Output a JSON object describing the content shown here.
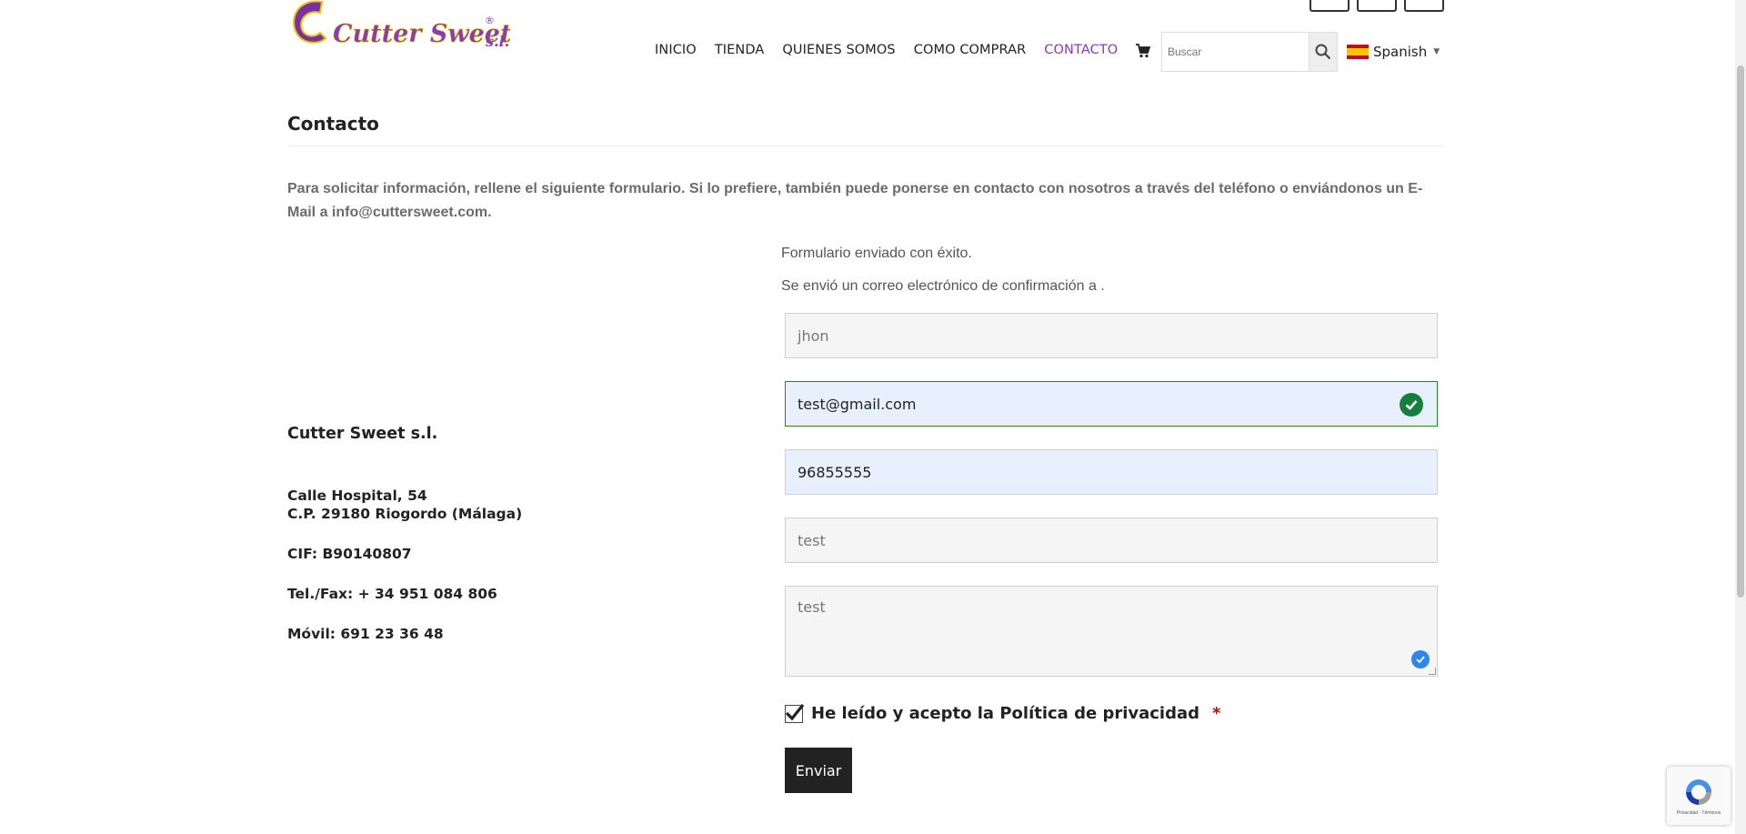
{
  "header": {
    "logo_text": "Cutter Sweet",
    "logo_suffix": "s.l.",
    "nav": [
      {
        "label": "INICIO"
      },
      {
        "label": "TIENDA"
      },
      {
        "label": "QUIENES SOMOS"
      },
      {
        "label": "COMO COMPRAR"
      },
      {
        "label": "CONTACTO",
        "active": true
      }
    ],
    "cart_icon": "shopping-cart-icon",
    "search": {
      "placeholder": "Buscar",
      "icon": "search-icon"
    },
    "language": {
      "label": "Spanish",
      "flag": "spain-flag-icon"
    }
  },
  "page": {
    "title": "Contacto",
    "intro": "Para solicitar información, rellene el siguiente formulario. Si lo prefiere, también puede ponerse en contacto con nosotros  a través del teléfono o enviándonos un E-Mail a info@cuttersweet.com."
  },
  "company": {
    "name": "Cutter Sweet s.l.",
    "address_line1": "Calle Hospital, 54",
    "address_line2": "C.P. 29180 Riogordo (Málaga)",
    "cif": "CIF: B90140807",
    "telfax": "Tel./Fax: + 34 951 084 806",
    "movil": "Móvil: 691 23 36 48"
  },
  "form": {
    "success_message": "Formulario enviado con éxito.",
    "confirmation_message": "Se envió un correo electrónico de confirmación a .",
    "name_value": "jhon",
    "email_value": "test@gmail.com",
    "phone_value": "96855555",
    "subject_value": "test",
    "message_value": "test",
    "consent_label": "He leído y acepto la Política de privacidad",
    "required_mark": "*",
    "submit_label": "Enviar"
  },
  "colors": {
    "accent_purple": "#8a3ab9",
    "valid_green": "#15803d",
    "button_dark": "#222222"
  }
}
